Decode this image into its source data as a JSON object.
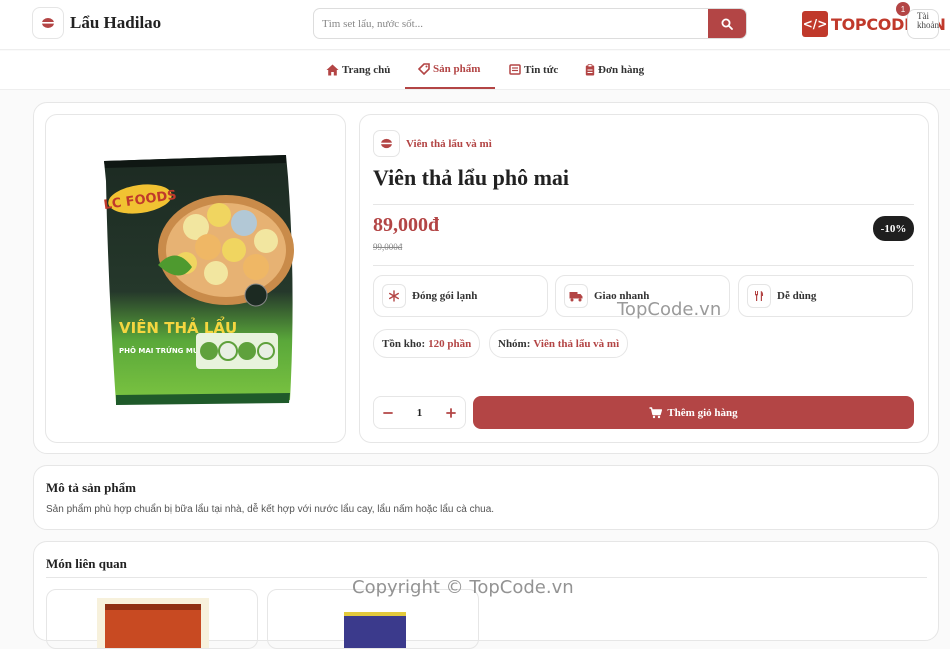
{
  "header": {
    "brand_name": "Lẩu Hadilao",
    "search_placeholder": "Tìm set lẩu, nước sốt...",
    "watermark_logo_text": "TOPCODE.VN",
    "user_label": "Tài khoản",
    "cart_count": "1"
  },
  "nav": {
    "items": [
      {
        "label": "Trang chủ",
        "icon": "home-icon"
      },
      {
        "label": "Sản phẩm",
        "icon": "tag-icon"
      },
      {
        "label": "Tin tức",
        "icon": "newspaper-icon"
      },
      {
        "label": "Đơn hàng",
        "icon": "clipboard-icon"
      }
    ],
    "active_index": 1
  },
  "product": {
    "category": "Viên thả lẩu và mì",
    "name": "Viên thả lẩu phô mai",
    "price": "89,000đ",
    "old_price": "99,000đ",
    "discount": "-10%",
    "package_brand": "LC FOODS",
    "package_title": "VIÊN THẢ LẨU",
    "package_subtitle": "PHÔ MAI TRỨNG MUỐI",
    "features": [
      {
        "label": "Đóng gói lạnh",
        "icon": "snowflake-icon"
      },
      {
        "label": "Giao nhanh",
        "icon": "truck-icon"
      },
      {
        "label": "Dễ dùng",
        "icon": "utensils-icon"
      }
    ],
    "stock_label": "Tồn kho:",
    "stock_value": "120 phần",
    "group_label": "Nhóm:",
    "group_value": "Viên thả lẩu và mì",
    "quantity": "1",
    "add_to_cart_label": "Thêm giỏ hàng"
  },
  "description": {
    "title": "Mô tả sản phẩm",
    "text": "Sản phẩm phù hợp chuẩn bị bữa lẩu tại nhà, dễ kết hợp với nước lẩu cay, lẩu nấm hoặc lẩu cà chua."
  },
  "related": {
    "title": "Món liên quan"
  },
  "watermarks": {
    "center": "TopCode.vn",
    "bottom": "Copyright © TopCode.vn"
  },
  "colors": {
    "accent": "#b34545",
    "dark_badge": "#1f1f1f"
  }
}
